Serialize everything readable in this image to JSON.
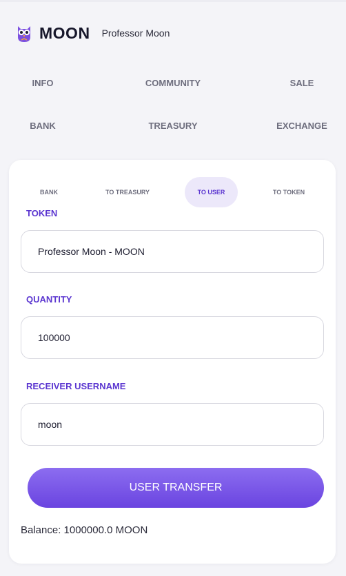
{
  "header": {
    "brand": "MOON",
    "username": "Professor Moon"
  },
  "nav": {
    "items": [
      "INFO",
      "COMMUNITY",
      "SALE",
      "BANK",
      "TREASURY",
      "EXCHANGE"
    ]
  },
  "transfer": {
    "tabs": [
      "BANK",
      "TO TREASURY",
      "TO USER",
      "TO TOKEN"
    ],
    "active_tab": "TO USER",
    "token_label": "TOKEN",
    "token_value": "Professor Moon - MOON",
    "quantity_label": "QUANTITY",
    "quantity_value": "100000",
    "receiver_label": "RECEIVER USERNAME",
    "receiver_value": "moon",
    "submit_label": "USER TRANSFER",
    "balance": "Balance: 1000000.0 MOON"
  },
  "colors": {
    "accent": "#5b36d0",
    "button_top": "#8c6df0",
    "button_bottom": "#6a44e0",
    "active_tab_bg": "#ece8fa"
  },
  "icons": {
    "logo": "owl-icon"
  }
}
